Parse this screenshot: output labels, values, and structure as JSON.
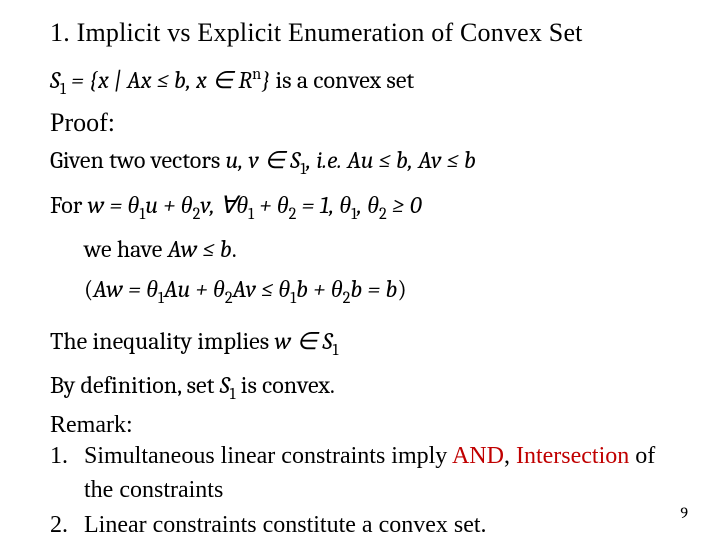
{
  "title": "1. Implicit vs Explicit Enumeration of Convex Set",
  "line_def_pre": "S",
  "line_def_sub": "1",
  "line_def_eq": " = {x | Ax ≤ b, x ∈ R",
  "line_def_sup": "n",
  "line_def_post": "} ",
  "line_def_tail": "is a convex set",
  "proof_label": "Proof:",
  "given_pre": "Given two vectors ",
  "given_uv": "u, v ∈ S",
  "given_sub1": "1",
  "given_mid": ", i.e. Au ≤ b, Av ≤ b",
  "for_pre": "For ",
  "for_w": "w = θ",
  "for_s1": "1",
  "for_mid1": "u + θ",
  "for_s2": "2",
  "for_mid2": "v, ∀θ",
  "for_s3": "1",
  "for_mid3": " + θ",
  "for_s4": "2",
  "for_mid4": " = 1, θ",
  "for_s5": "1",
  "for_mid5": ", θ",
  "for_s6": "2",
  "for_tail": " ≥ 0",
  "wehave_pre": "we have ",
  "wehave_math": "Aw ≤ b",
  "wehave_dot": ".",
  "aw_open": "(",
  "aw_1": "Aw = θ",
  "aw_s1": "1",
  "aw_2": "Au + θ",
  "aw_s2": "2",
  "aw_3": "Av ≤ θ",
  "aw_s3": "1",
  "aw_4": "b + θ",
  "aw_s4": "2",
  "aw_5": "b = b",
  "aw_close": ")",
  "ineq_pre": "The inequality implies ",
  "ineq_math": "w ∈ S",
  "ineq_sub": "1",
  "bydef_pre": "By definition, set ",
  "bydef_math": "S",
  "bydef_sub": "1",
  "bydef_tail": " is convex.",
  "remark_label": "Remark:",
  "item1_num": "1.",
  "item1_a": "Simultaneous linear constraints imply ",
  "item1_and": "AND",
  "item1_b": ", ",
  "item1_intersection": "Intersection",
  "item1_c": " of the constraints",
  "item2_num": "2.",
  "item2_text": "Linear constraints constitute a convex set.",
  "page_number": "9"
}
